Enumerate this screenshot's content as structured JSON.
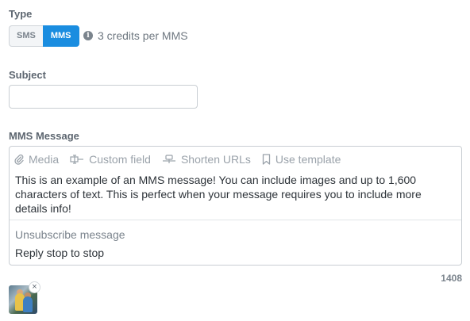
{
  "type_section": {
    "label": "Type",
    "options": [
      "SMS",
      "MMS"
    ],
    "selected": "MMS",
    "credits_info": "3 credits per MMS"
  },
  "subject": {
    "label": "Subject",
    "value": ""
  },
  "message": {
    "label": "MMS Message",
    "toolbar": {
      "media": "Media",
      "custom_field": "Custom field",
      "shorten_urls": "Shorten URLs",
      "use_template": "Use template"
    },
    "body": "This is an example of an MMS message! You can include images and up to 1,600 characters of text. This is perfect when your message requires you to include more details info!",
    "unsubscribe_label": "Unsubscribe message",
    "unsubscribe_text": "Reply stop to stop",
    "char_count": "1408"
  },
  "attachment": {
    "remove": "×"
  },
  "colors": {
    "accent": "#1a8de0",
    "muted": "#7b848d"
  }
}
